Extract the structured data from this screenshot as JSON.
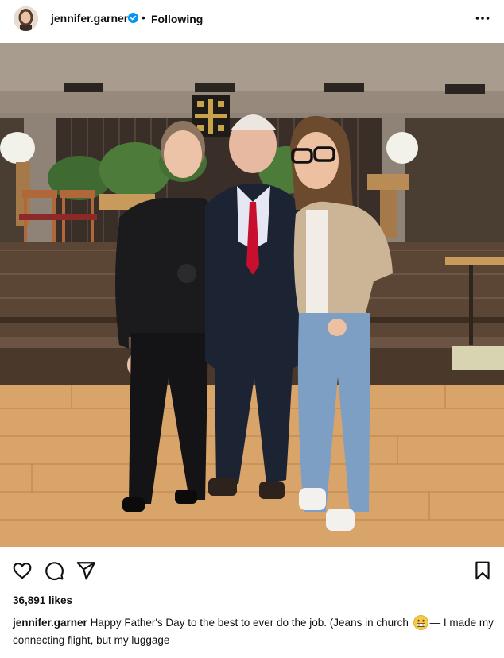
{
  "post": {
    "username": "jennifer.garner",
    "separator": "•",
    "follow_status": "Following",
    "verified_icon": "verified-badge-icon",
    "more_icon": "more-options-icon"
  },
  "actions": {
    "like_icon": "heart-icon",
    "comment_icon": "comment-icon",
    "share_icon": "share-icon",
    "save_icon": "bookmark-icon"
  },
  "likes_text": "36,891 likes",
  "caption": {
    "username": "jennifer.garner",
    "text_before_emoji": "Happy Father's Day to the best to ever do the job. (Jeans in church",
    "emoji": "grimacing-face-icon",
    "text_after_emoji": "— I made my connecting flight, but my luggage"
  },
  "colors": {
    "verified_blue": "#0095f6",
    "text": "#111111",
    "tie_red": "#c8102e",
    "floor": "#d9a46a"
  }
}
